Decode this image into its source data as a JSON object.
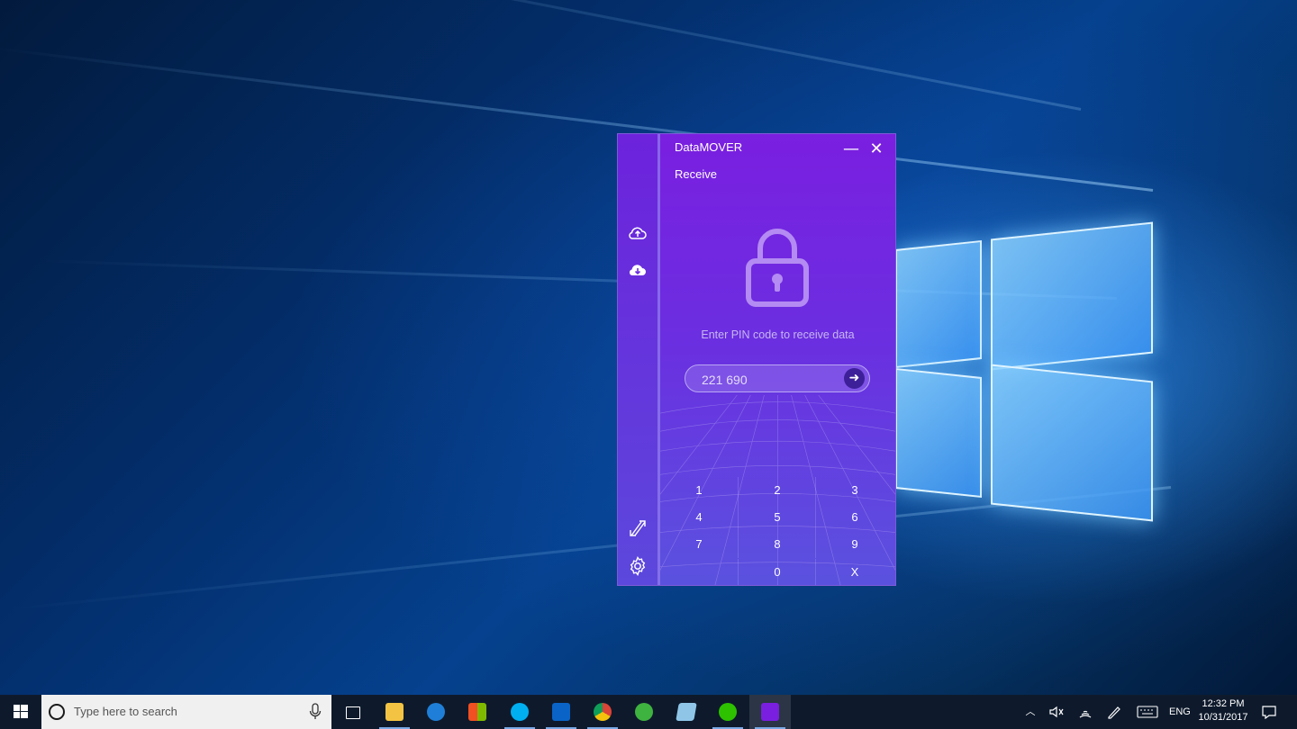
{
  "app": {
    "title": "DataMOVER",
    "section": "Receive",
    "minimize_glyph": "—",
    "close_glyph": "✕",
    "prompt": "Enter PIN code to receive data",
    "pin_value": "221 690",
    "submit_glyph": "➜",
    "accent": "#7a1fe0",
    "sidebar_icons": [
      "cloud-upload-icon",
      "cloud-download-icon",
      "transfer-icon",
      "gear-icon"
    ],
    "keypad": [
      "1",
      "2",
      "3",
      "4",
      "5",
      "6",
      "7",
      "8",
      "9",
      "0",
      "X"
    ]
  },
  "taskbar": {
    "search_placeholder": "Type here to search",
    "apps": [
      "task-view-icon",
      "file-explorer-icon",
      "edge-icon",
      "store-icon",
      "skype-icon",
      "outlook-icon",
      "chrome-icon",
      "green-app-icon",
      "notes-icon",
      "wechat-icon",
      "datamover-icon"
    ],
    "language": "ENG",
    "time": "12:32 PM",
    "date": "10/31/2017"
  }
}
